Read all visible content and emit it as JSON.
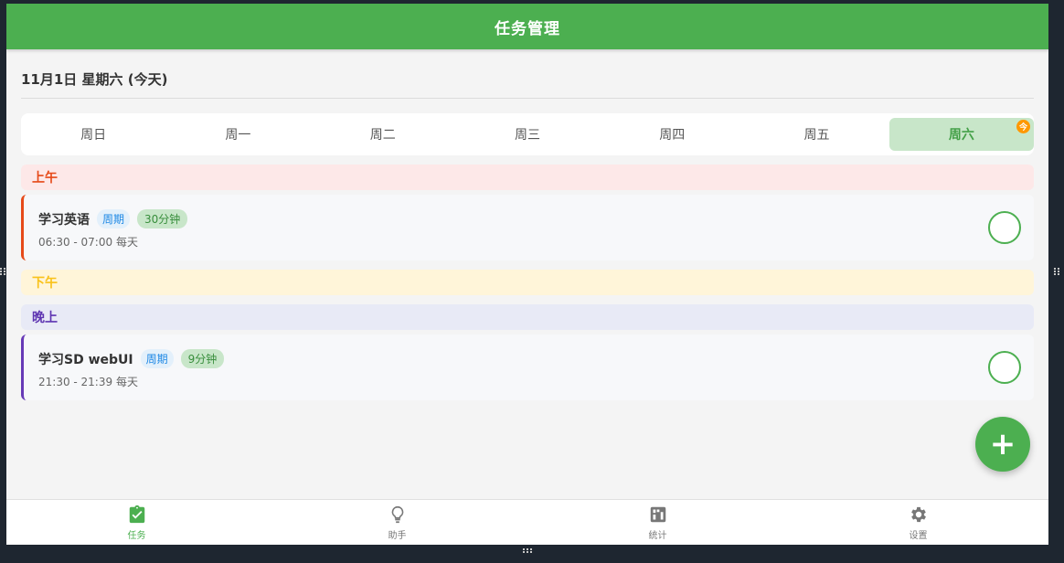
{
  "app": {
    "title": "任务管理"
  },
  "date_header": "11月1日 星期六 (今天)",
  "week": {
    "days": [
      "周日",
      "周一",
      "周二",
      "周三",
      "周四",
      "周五",
      "周六"
    ],
    "active_index": 6,
    "today_badge": "今"
  },
  "sections": {
    "morning": "上午",
    "afternoon": "下午",
    "evening": "晚上"
  },
  "tasks": [
    {
      "name": "学习英语",
      "period_tag": "周期",
      "duration_tag": "30分钟",
      "time": "06:30 - 07:00 每天",
      "accent": "#e64a19"
    },
    {
      "name": "学习SD webUI",
      "period_tag": "周期",
      "duration_tag": "9分钟",
      "time": "21:30 - 21:39 每天",
      "accent": "#673ab7"
    }
  ],
  "fab_label": "+",
  "nav": {
    "items": [
      {
        "label": "任务",
        "icon": "task-check-icon"
      },
      {
        "label": "助手",
        "icon": "lightbulb-icon"
      },
      {
        "label": "统计",
        "icon": "stats-icon"
      },
      {
        "label": "设置",
        "icon": "gear-icon"
      }
    ],
    "active_index": 0
  },
  "colors": {
    "primary": "#4caf50",
    "morning": "#e64a19",
    "afternoon": "#f9c21a",
    "evening": "#5e35b1"
  }
}
